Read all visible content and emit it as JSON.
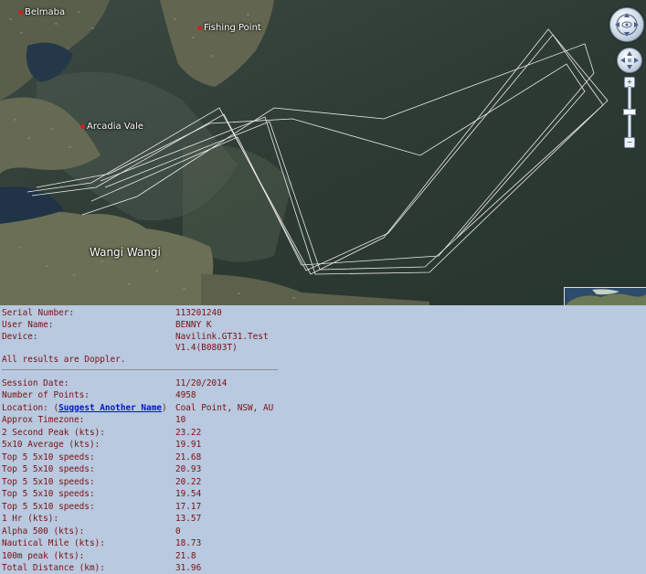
{
  "map": {
    "places": {
      "belmont": "Belmaba",
      "fishing_point": "Fishing Point",
      "arcadia_vale": "Arcadia Vale",
      "wangi_wangi": "Wangi Wangi"
    },
    "controls": {
      "zoom_in": "+",
      "zoom_out": "−"
    },
    "colors": {
      "water": "#2f3c35",
      "land": "#5e6650",
      "track": "#ffffff"
    }
  },
  "device": {
    "serial_label": "Serial Number:",
    "serial_value": "113201240",
    "user_label": "User Name:",
    "user_value": "BENNY K",
    "device_label": "Device:",
    "device_value_1": "Navilink.GT31.Test",
    "device_value_2": "V1.4(B0803T)",
    "note": "All results are Doppler."
  },
  "session": {
    "date_label": "Session Date:",
    "date_value": "11/20/2014",
    "points_label": "Number of Points:",
    "points_value": "4958",
    "location_label_pre": "Location: (",
    "location_link": "Suggest Another Name",
    "location_label_post": ")",
    "location_value": "Coal Point, NSW, AU",
    "tz_label": "Approx Timezone:",
    "tz_value": "10",
    "peak2_label": "2 Second Peak (kts):",
    "peak2_value": "23.22",
    "avg5x10_label": "5x10 Average (kts):",
    "avg5x10_value": "19.91",
    "top5": [
      {
        "label": "Top 5 5x10 speeds:",
        "value": "21.68"
      },
      {
        "label": "Top 5 5x10 speeds:",
        "value": "20.93"
      },
      {
        "label": "Top 5 5x10 speeds:",
        "value": "20.22"
      },
      {
        "label": "Top 5 5x10 speeds:",
        "value": "19.54"
      },
      {
        "label": "Top 5 5x10 speeds:",
        "value": "17.17"
      }
    ],
    "hr1_label": "1 Hr (kts):",
    "hr1_value": "13.57",
    "alpha_label": "Alpha 500 (kts):",
    "alpha_value": "0",
    "nm_label": "Nautical Mile (kts):",
    "nm_value": "18.73",
    "peak100_label": "100m peak (kts):",
    "peak100_value": "21.8",
    "dist_label": "Total Distance (km):",
    "dist_value": "31.96"
  }
}
